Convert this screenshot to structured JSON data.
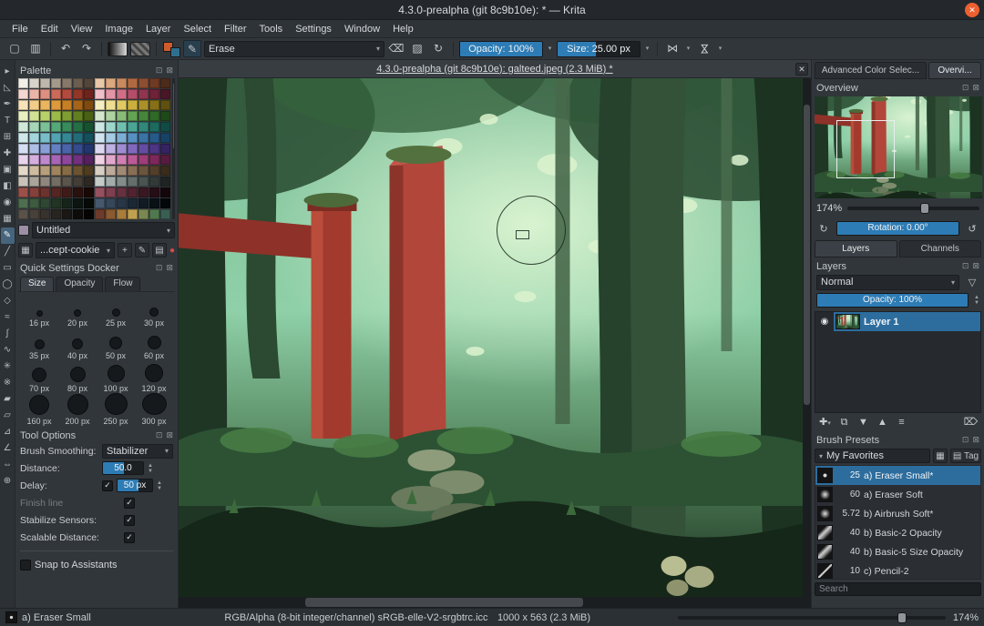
{
  "colors": {
    "accent": "#3daee9",
    "slider_fill": "#2d7cb5",
    "selection": "#2d6d9e",
    "close_button": "#ed5f30",
    "panel": "#31363b",
    "input_dark": "#1d2023"
  },
  "titlebar": {
    "title": "4.3.0-prealpha (git 8c9b10e): * — Krita"
  },
  "menubar": {
    "items": [
      "File",
      "Edit",
      "View",
      "Image",
      "Layer",
      "Select",
      "Filter",
      "Tools",
      "Settings",
      "Window",
      "Help"
    ]
  },
  "toolbar": {
    "blend_mode": "Erase",
    "opacity": "Opacity: 100%",
    "size": "Size: 25.00 px"
  },
  "icons": {
    "docker_float": "⊡",
    "docker_close": "⊠",
    "dropdown": "▾",
    "undo": "↶",
    "redo": "↷",
    "reload": "↻",
    "eraser": "⌫",
    "mirror": "⋈",
    "add": "✚",
    "duplicate": "⧉",
    "arrow_down": "▼",
    "arrow_up": "▲",
    "properties": "≡",
    "delete": "⌦",
    "eye": "◉",
    "funnel": "▽",
    "pen": "✎",
    "plus": "+",
    "grid": "▦",
    "stack": "▤",
    "rotate": "↻",
    "rotate_reset": "↺",
    "tag_box": "▤",
    "new_doc": "▢",
    "open_doc": "▥",
    "brush_editor": "✎",
    "checker": "▨",
    "close": "✕"
  },
  "toolbox": {
    "tools": [
      {
        "name": "shape-select",
        "glyph": "▸"
      },
      {
        "name": "edit-shapes",
        "glyph": "◺"
      },
      {
        "name": "calligraphy",
        "glyph": "✒"
      },
      {
        "name": "text",
        "glyph": "T"
      },
      {
        "name": "transform",
        "glyph": "⊞"
      },
      {
        "name": "move",
        "glyph": "✚"
      },
      {
        "name": "crop",
        "glyph": "▣"
      },
      {
        "name": "gradient",
        "glyph": "◧"
      },
      {
        "name": "color-picker",
        "glyph": "◉"
      },
      {
        "name": "pattern-edit",
        "glyph": "▦"
      },
      {
        "name": "freehand-brush",
        "glyph": "✎",
        "active": true
      },
      {
        "name": "line",
        "glyph": "╱"
      },
      {
        "name": "rectangle",
        "glyph": "▭"
      },
      {
        "name": "ellipse",
        "glyph": "◯"
      },
      {
        "name": "polygon",
        "glyph": "◇"
      },
      {
        "name": "polyline",
        "glyph": "≈"
      },
      {
        "name": "bezier-curve",
        "glyph": "∫"
      },
      {
        "name": "freehand-path",
        "glyph": "∿"
      },
      {
        "name": "dynamic-brush",
        "glyph": "✳"
      },
      {
        "name": "multibrush",
        "glyph": "※"
      },
      {
        "name": "fill",
        "glyph": "▰"
      },
      {
        "name": "enclose-fill",
        "glyph": "▱"
      },
      {
        "name": "assistants",
        "glyph": "⊿"
      },
      {
        "name": "measure",
        "glyph": "∠"
      },
      {
        "name": "pan",
        "glyph": "⇔"
      },
      {
        "name": "zoom",
        "glyph": "⊕"
      }
    ]
  },
  "palette": {
    "title": "Palette",
    "name_combo": "Untitled",
    "resource_combo": "...cept-cookie",
    "colors": [
      "#f2efe9",
      "#d9d4cb",
      "#bfb7ab",
      "#a39a8c",
      "#87796a",
      "#6b5d4f",
      "#52463a",
      "#e9c9a8",
      "#dba87f",
      "#c98a5e",
      "#b06a42",
      "#8f4e30",
      "#6e3a24",
      "#4e2a1a",
      "#f4d7d0",
      "#eab4a8",
      "#dd8f80",
      "#cc6a5a",
      "#b44a3e",
      "#933527",
      "#6e241a",
      "#f0c0c8",
      "#e295a5",
      "#cf6e85",
      "#b44d68",
      "#92344e",
      "#6e2338",
      "#4a1625",
      "#f8e3b8",
      "#f2cd8a",
      "#eab55e",
      "#dd9a3a",
      "#c77f24",
      "#a66418",
      "#7f4a10",
      "#f6eec2",
      "#eede92",
      "#dfc963",
      "#cbaf3d",
      "#ab9027",
      "#857018",
      "#5f500f",
      "#e7eec0",
      "#d2e295",
      "#b8d16a",
      "#9cba47",
      "#7f9e30",
      "#62801f",
      "#486112",
      "#d4e6cc",
      "#aed3a0",
      "#88bc77",
      "#64a254",
      "#47863a",
      "#2f6827",
      "#1d4a18",
      "#cfe8d8",
      "#a5d6b8",
      "#7cc097",
      "#55a878",
      "#388c5c",
      "#247044",
      "#16522f",
      "#cce8e2",
      "#9dd6cb",
      "#70c0b1",
      "#4aa595",
      "#30887a",
      "#1d6a5e",
      "#104c43",
      "#cfe8ea",
      "#a3d5dc",
      "#78bec9",
      "#52a4b3",
      "#368897",
      "#226c7a",
      "#13505c",
      "#d0e4f0",
      "#a6cbe4",
      "#7caed4",
      "#5790c0",
      "#3a73a6",
      "#265a88",
      "#164266",
      "#d4ddf2",
      "#aebfe6",
      "#889fd6",
      "#6580c2",
      "#4a64aa",
      "#344b8e",
      "#22356e",
      "#dcd6f0",
      "#bdb0e2",
      "#9e8cd2",
      "#8069bd",
      "#654ca3",
      "#4c3585",
      "#352263",
      "#e8d4ec",
      "#d4aede",
      "#bf88cc",
      "#a865b6",
      "#8f479c",
      "#73307e",
      "#55205e",
      "#f0d2e4",
      "#e2a8cc",
      "#d07fb2",
      "#ba5a96",
      "#9e3d78",
      "#7d285a",
      "#591a3f",
      "#e4d8c8",
      "#cfbba0",
      "#b89f7c",
      "#a0845d",
      "#876b44",
      "#6c5330",
      "#503c20",
      "#d8cfc4",
      "#bcab9a",
      "#a18a74",
      "#876e55",
      "#6c553d",
      "#523f2a",
      "#3a2b1b",
      "#c8c2b8",
      "#aba49a",
      "#8f877d",
      "#746d63",
      "#5b544b",
      "#433d35",
      "#2d2822",
      "#c4ccc8",
      "#a2aca8",
      "#828c88",
      "#646e6a",
      "#49534f",
      "#323a37",
      "#1f2422",
      "#9c5048",
      "#84403a",
      "#6c322d",
      "#552621",
      "#3f1b17",
      "#2a110e",
      "#180806",
      "#96505f",
      "#7e3f4e",
      "#66303e",
      "#4f232f",
      "#391821",
      "#250e15",
      "#14060a",
      "#4e6e50",
      "#3e5a40",
      "#2f4732",
      "#223525",
      "#16241a",
      "#0c150f",
      "#050a06",
      "#45586e",
      "#36475a",
      "#283747",
      "#1b2835",
      "#111b24",
      "#091016",
      "#040709",
      "#5a5248",
      "#48413a",
      "#37322c",
      "#28241f",
      "#1a1714",
      "#0e0c0a",
      "#050403",
      "#6e3a2a",
      "#8a5a30",
      "#a87c3a",
      "#c0a050",
      "#7a8850",
      "#50784e",
      "#3a5e52"
    ]
  },
  "quick_settings": {
    "title": "Quick Settings Docker",
    "tabs": [
      "Size",
      "Opacity",
      "Flow"
    ],
    "active_tab": "Size",
    "sizes": [
      {
        "label": "16 px",
        "d": 7
      },
      {
        "label": "20 px",
        "d": 8
      },
      {
        "label": "25 px",
        "d": 9
      },
      {
        "label": "30 px",
        "d": 10
      },
      {
        "label": "35 px",
        "d": 11
      },
      {
        "label": "40 px",
        "d": 12
      },
      {
        "label": "50 px",
        "d": 14
      },
      {
        "label": "60 px",
        "d": 15
      },
      {
        "label": "70 px",
        "d": 16
      },
      {
        "label": "80 px",
        "d": 17
      },
      {
        "label": "100 px",
        "d": 19
      },
      {
        "label": "120 px",
        "d": 20
      },
      {
        "label": "160 px",
        "d": 22
      },
      {
        "label": "200 px",
        "d": 23
      },
      {
        "label": "250 px",
        "d": 25
      },
      {
        "label": "300 px",
        "d": 27
      }
    ]
  },
  "tool_options": {
    "title": "Tool Options",
    "brush_smoothing_label": "Brush Smoothing:",
    "brush_smoothing_value": "Stabilizer",
    "distance_label": "Distance:",
    "distance_value": "50.0",
    "delay_label": "Delay:",
    "delay_value": "50 px",
    "finish_line_label": "Finish line",
    "stabilize_sensors_label": "Stabilize Sensors:",
    "scalable_distance_label": "Scalable Distance:",
    "snap_label": "Snap to Assistants"
  },
  "canvas": {
    "tab_title": "4.3.0-prealpha (git 8c9b10e): galteed.jpeg (2.3 MiB) *"
  },
  "overview": {
    "tab_advanced": "Advanced Color Selec...",
    "tab_overview": "Overvi...",
    "title": "Overview",
    "zoom": "174%",
    "rotation": "Rotation: 0.00°"
  },
  "layers": {
    "tab_layers": "Layers",
    "tab_channels": "Channels",
    "title": "Layers",
    "blend_mode": "Normal",
    "opacity": "Opacity: 100%",
    "layer_name": "Layer 1"
  },
  "brush_presets": {
    "title": "Brush Presets",
    "favorites": "My Favorites",
    "tag_label": "Tag",
    "search_placeholder": "Search",
    "selected_index": 0,
    "items": [
      {
        "size": "25",
        "name": "a) Eraser Small*",
        "thumb": "dot-small"
      },
      {
        "size": "60",
        "name": "a) Eraser Soft",
        "thumb": "dot-soft"
      },
      {
        "size": "5.72",
        "name": "b) Airbrush Soft*",
        "thumb": "dot-soft"
      },
      {
        "size": "40",
        "name": "b) Basic-2 Opacity",
        "thumb": "stroke"
      },
      {
        "size": "40",
        "name": "b) Basic-5 Size Opacity",
        "thumb": "stroke"
      },
      {
        "size": "10",
        "name": "c) Pencil-2",
        "thumb": "pencil"
      }
    ]
  },
  "statusbar": {
    "brush": "a) Eraser Small",
    "colorspace": "RGB/Alpha (8-bit integer/channel)  sRGB-elle-V2-srgbtrc.icc",
    "doc_size": "1000 x 563 (2.3 MiB)",
    "zoom": "174%"
  }
}
